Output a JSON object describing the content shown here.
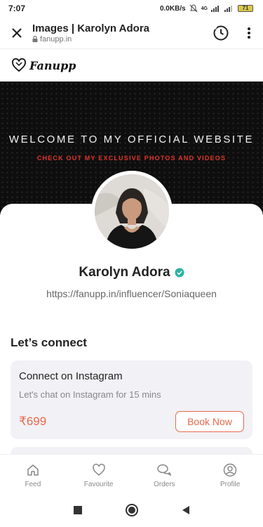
{
  "status_bar": {
    "time": "7:07",
    "speed": "0.0KB/s",
    "network": "4G",
    "battery": "71"
  },
  "browser": {
    "title": "Images | Karolyn Adora",
    "url": "fanupp.in",
    "close_icon": "close-icon",
    "history_icon": "history-icon",
    "menu_icon": "more-vert-icon"
  },
  "brand": {
    "name": "Fanupp",
    "logo_icon": "heart-icon"
  },
  "hero": {
    "title": "WELCOME TO MY OFFICIAL WEBSITE",
    "subtitle": "CHECK OUT MY EXCLUSIVE PHOTOS AND VIDEOS"
  },
  "profile": {
    "name": "Karolyn Adora",
    "verified_icon": "verified-badge-icon",
    "url": "https://fanupp.in/influencer/Soniaqueen"
  },
  "connect": {
    "heading": "Let’s connect",
    "card": {
      "title": "Connect on Instagram",
      "description": "Let's chat on Instagram for 15 mins",
      "price": "₹699",
      "button": "Book Now"
    }
  },
  "bottom_nav": {
    "items": [
      {
        "label": "Feed",
        "icon": "home-icon"
      },
      {
        "label": "Favourite",
        "icon": "heart-outline-icon"
      },
      {
        "label": "Orders",
        "icon": "chat-bubbles-icon"
      },
      {
        "label": "Profile",
        "icon": "user-circle-icon"
      }
    ]
  },
  "colors": {
    "accent": "#e8694b",
    "hero_subtitle": "#e0352b",
    "verified": "#2bb3a3"
  }
}
